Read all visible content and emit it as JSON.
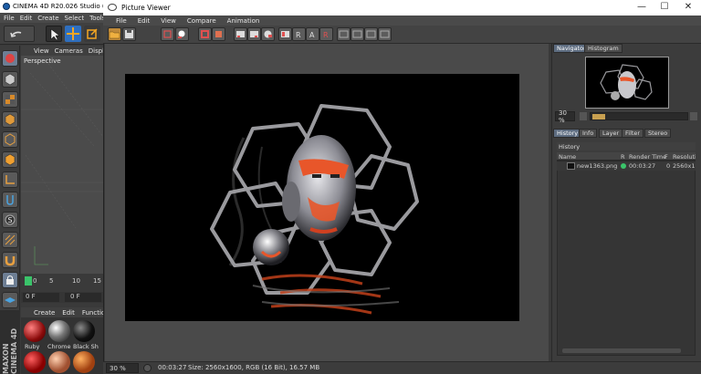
{
  "c4d": {
    "title": "CINEMA 4D R20.026 Studio (RC - I",
    "menu": [
      "File",
      "Edit",
      "Create",
      "Select",
      "Tools"
    ],
    "viewport_menu": [
      "View",
      "Cameras",
      "Display"
    ],
    "viewport_label": "Perspective",
    "timeline_ticks": [
      "0",
      "5",
      "10",
      "15"
    ],
    "frame_field": "0 F",
    "frame_field2": "0 F",
    "material_menu": [
      "Create",
      "Edit",
      "Function"
    ],
    "materials": [
      "Ruby",
      "Chrome",
      "Black Sh"
    ],
    "brand": "MAXON CINEMA 4D"
  },
  "picture_viewer": {
    "title": "Picture Viewer",
    "menu": [
      "File",
      "Edit",
      "View",
      "Compare",
      "Animation"
    ],
    "status": {
      "zoom": "30 %",
      "time": "00:03:27",
      "info": "Size: 2560x1600, RGB (16 Bit), 16.57 MB"
    }
  },
  "right_panel": {
    "top_tabs": [
      "Navigator",
      "Histogram"
    ],
    "nav_zoom": "30 %",
    "bottom_tabs": [
      "History",
      "Info",
      "Layer",
      "Filter",
      "Stereo"
    ],
    "history_header": "History",
    "columns": [
      "Name",
      "R",
      "Render Time",
      "F",
      "Resolutio"
    ],
    "rows": [
      {
        "name": "new1363.png",
        "render_time": "00:03:27",
        "f": "0",
        "resolution": "2560x1"
      }
    ]
  },
  "colors": {
    "accent_orange": "#e8562a",
    "active_tab": "#5d6c80",
    "status_green": "#3ac46a"
  }
}
